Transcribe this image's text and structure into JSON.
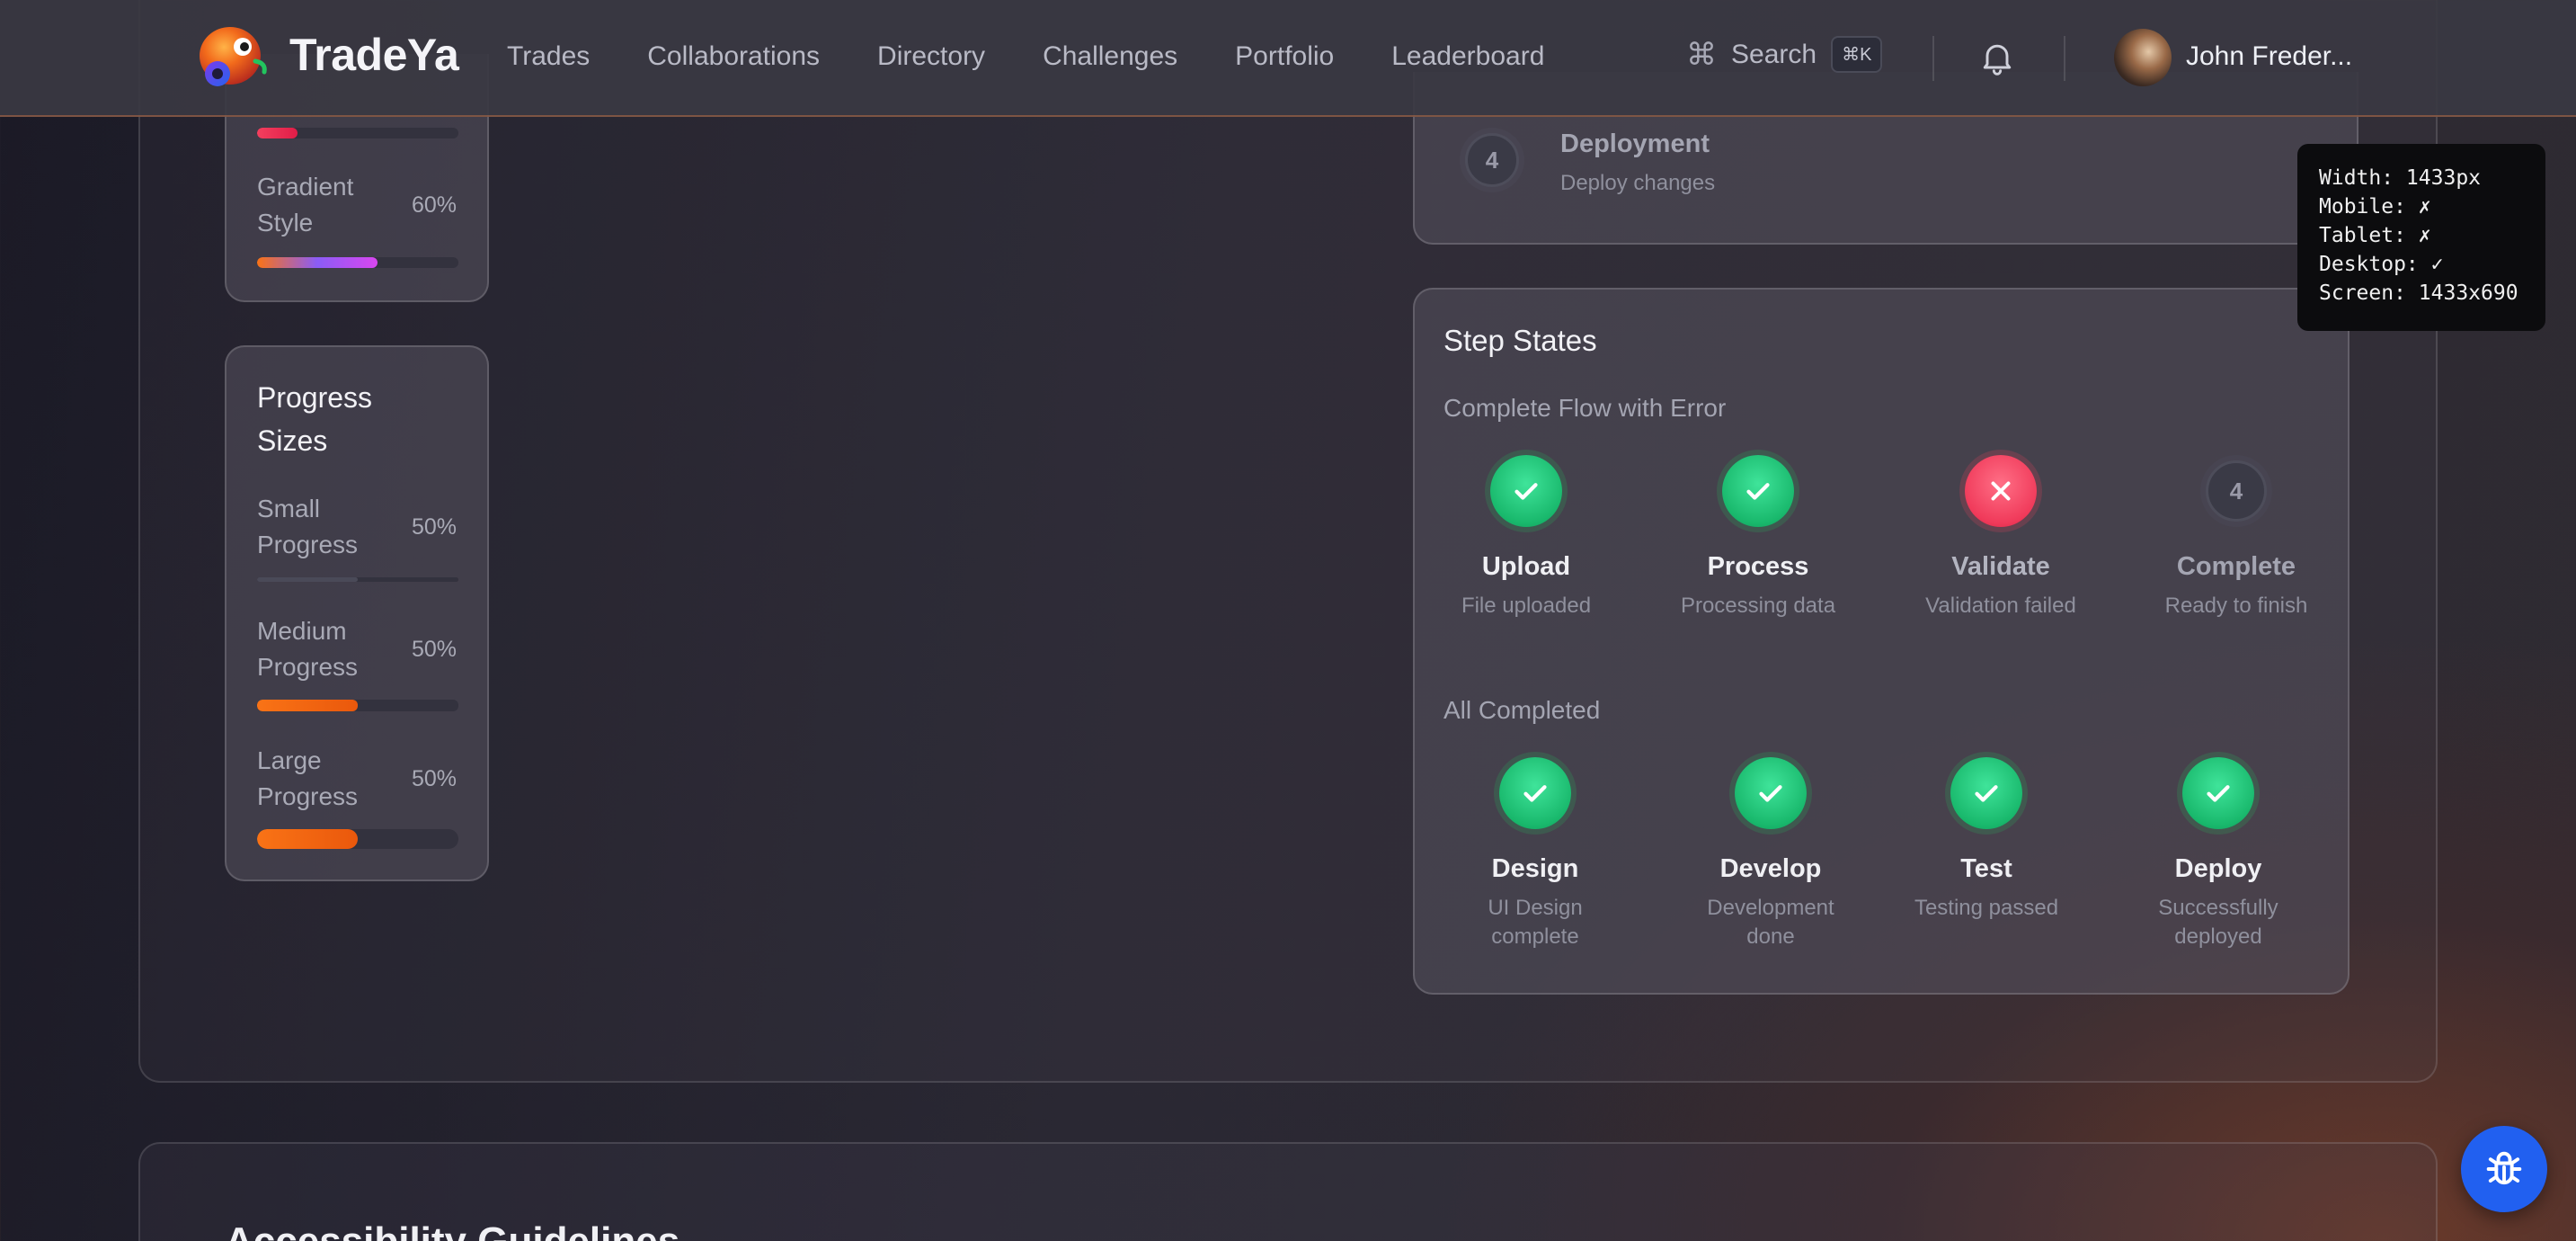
{
  "header": {
    "brand": "TradeYa",
    "nav": [
      "Trades",
      "Collaborations",
      "Directory",
      "Challenges",
      "Portfolio",
      "Leaderboard"
    ],
    "search_label": "Search",
    "search_shortcut": "⌘K",
    "user_name": "John Freder..."
  },
  "progress_top": {
    "items": [
      {
        "label": "Gradient Style",
        "value": "60%",
        "fraction": 0.6
      }
    ],
    "partial_bar_fraction": 0.2
  },
  "progress_sizes": {
    "title": "Progress Sizes",
    "items": [
      {
        "label": "Small Progress",
        "value": "50%",
        "fraction": 0.5
      },
      {
        "label": "Medium Progress",
        "value": "50%",
        "fraction": 0.5
      },
      {
        "label": "Large Progress",
        "value": "50%",
        "fraction": 0.5
      }
    ]
  },
  "deployment_step": {
    "number": "4",
    "title": "Deployment",
    "description": "Deploy changes"
  },
  "step_states": {
    "title": "Step States",
    "flow_error": {
      "label": "Complete Flow with Error",
      "steps": [
        {
          "name": "Upload",
          "desc": "File uploaded",
          "state": "complete"
        },
        {
          "name": "Process",
          "desc": "Processing data",
          "state": "complete"
        },
        {
          "name": "Validate",
          "desc": "Validation failed",
          "state": "error"
        },
        {
          "name": "Complete",
          "desc": "Ready to finish",
          "state": "pending",
          "number": "4"
        }
      ]
    },
    "all_completed": {
      "label": "All Completed",
      "steps": [
        {
          "name": "Design",
          "desc": "UI Design complete",
          "state": "complete"
        },
        {
          "name": "Develop",
          "desc": "Development done",
          "state": "complete"
        },
        {
          "name": "Test",
          "desc": "Testing passed",
          "state": "complete"
        },
        {
          "name": "Deploy",
          "desc": "Successfully deployed",
          "state": "complete"
        }
      ]
    }
  },
  "debug_tooltip": {
    "lines": [
      "Width: 1433px",
      "Mobile: ✗",
      "Tablet: ✗",
      "Desktop: ✓",
      "Screen: 1433x690"
    ]
  },
  "accessibility": {
    "title": "Accessibility Guidelines"
  },
  "colors": {
    "accent": "#f97316",
    "success": "#22c55e",
    "error": "#f43f5e",
    "debug_button": "#2160f0"
  }
}
